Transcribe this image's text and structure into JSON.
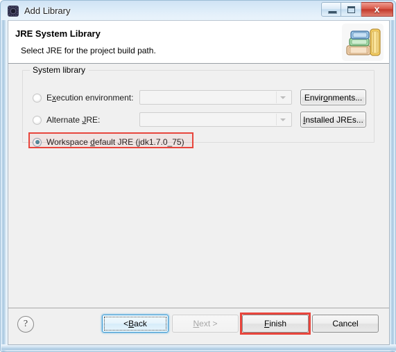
{
  "window": {
    "title": "Add Library",
    "icon": "eclipse-dialog-icon",
    "minimize_label": "Minimize",
    "maximize_label": "Maximize",
    "close_label": "x"
  },
  "header": {
    "title": "JRE System Library",
    "description": "Select JRE for the project build path.",
    "icon": "books-stack-icon"
  },
  "group": {
    "legend": "System library",
    "options": [
      {
        "id": "execution-environment",
        "label_pre": "E",
        "label_mnemonic": "x",
        "label_post": "ecution environment:",
        "selected": false,
        "enabled": false,
        "combo_value": "",
        "button_pre": "Envir",
        "button_mnemonic": "o",
        "button_post": "nments...",
        "button_full": "Environments..."
      },
      {
        "id": "alternate-jre",
        "label_pre": "Alternate ",
        "label_mnemonic": "J",
        "label_post": "RE:",
        "selected": false,
        "enabled": false,
        "combo_value": "",
        "button_pre": "",
        "button_mnemonic": "I",
        "button_post": "nstalled JREs...",
        "button_full": "Installed JREs..."
      },
      {
        "id": "workspace-default-jre",
        "label_pre": "Workspace ",
        "label_mnemonic": "d",
        "label_post": "efault JRE (jdk1.7.0_75)",
        "selected": true,
        "enabled": true,
        "highlighted": true
      }
    ]
  },
  "footer": {
    "help_label": "?",
    "buttons": [
      {
        "id": "back",
        "pre": "< ",
        "mnemonic": "B",
        "post": "ack",
        "full": "< Back",
        "state": "focused"
      },
      {
        "id": "next",
        "pre": "",
        "mnemonic": "N",
        "post": "ext >",
        "full": "Next >",
        "state": "disabled"
      },
      {
        "id": "finish",
        "pre": "",
        "mnemonic": "F",
        "post": "inish",
        "full": "Finish",
        "state": "highlighted"
      },
      {
        "id": "cancel",
        "pre": "Cancel",
        "mnemonic": "",
        "post": "",
        "full": "Cancel",
        "state": "normal"
      }
    ]
  },
  "colors": {
    "annotation": "#e8453c",
    "titlebar_glass": "#dceaf7",
    "dialog_bg": "#f0f0f0",
    "header_bg": "#ffffff",
    "radio_selected_dot": "#1c5d72",
    "close_button": "#c33a2c"
  }
}
